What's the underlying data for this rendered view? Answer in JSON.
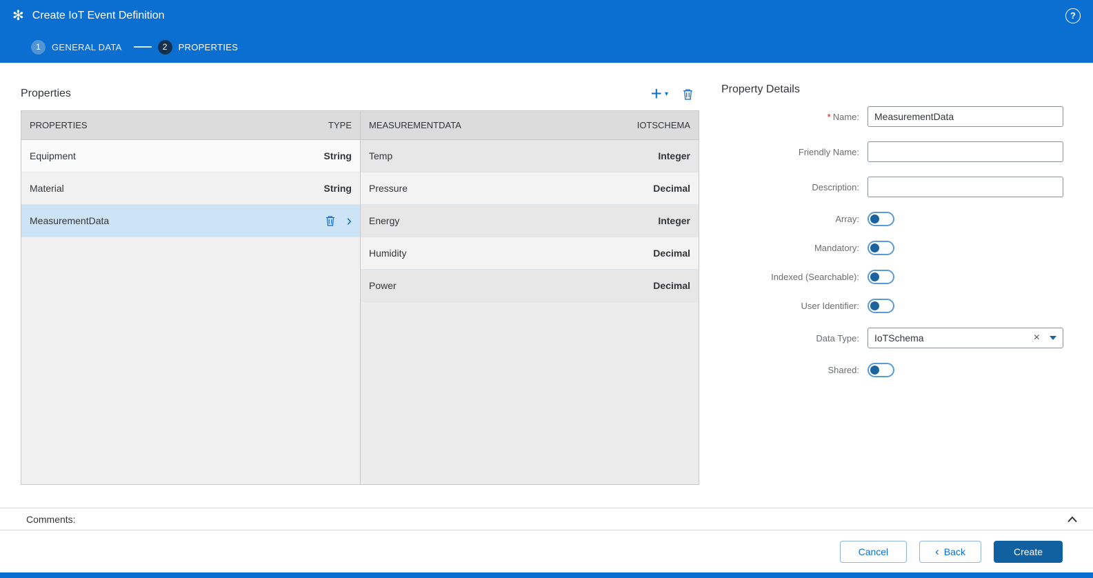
{
  "colors": {
    "header_blue": "#0a6fd1",
    "accent_blue": "#0a6ed1",
    "primary_button_blue": "#1161a0",
    "selected_row_blue": "#cde4f7"
  },
  "header": {
    "title": "Create IoT Event Definition",
    "logo_glyph": "✻",
    "help_glyph": "?"
  },
  "wizard": {
    "steps": [
      {
        "number": "1",
        "label": "GENERAL DATA",
        "state": "completed"
      },
      {
        "number": "2",
        "label": "PROPERTIES",
        "state": "active"
      }
    ]
  },
  "properties": {
    "title": "Properties",
    "toolbar": {
      "add_glyph": "+",
      "add_caret": "▾"
    },
    "main_table": {
      "headers": {
        "name": "PROPERTIES",
        "type": "TYPE"
      },
      "rows": [
        {
          "name": "Equipment",
          "type": "String"
        },
        {
          "name": "Material",
          "type": "String"
        },
        {
          "name": "MeasurementData",
          "type": "",
          "selected": true
        }
      ]
    },
    "sub_table": {
      "headers": {
        "name": "MEASUREMENTDATA",
        "type": "IOTSCHEMA"
      },
      "rows": [
        {
          "name": "Temp",
          "type": "Integer"
        },
        {
          "name": "Pressure",
          "type": "Decimal"
        },
        {
          "name": "Energy",
          "type": "Integer"
        },
        {
          "name": "Humidity",
          "type": "Decimal"
        },
        {
          "name": "Power",
          "type": "Decimal"
        }
      ]
    },
    "row_chevron": "›"
  },
  "details": {
    "title": "Property Details",
    "required_marker": "*",
    "name": {
      "label": "Name:",
      "value": "MeasurementData"
    },
    "friendly_name": {
      "label": "Friendly Name:",
      "value": ""
    },
    "description": {
      "label": "Description:",
      "value": ""
    },
    "array": {
      "label": "Array:",
      "state": "off"
    },
    "mandatory": {
      "label": "Mandatory:",
      "state": "off"
    },
    "indexed": {
      "label": "Indexed (Searchable):",
      "state": "off"
    },
    "user_identifier": {
      "label": "User Identifier:",
      "state": "off"
    },
    "data_type": {
      "label": "Data Type:",
      "value": "IoTSchema",
      "clear_glyph": "×"
    },
    "shared": {
      "label": "Shared:",
      "state": "off"
    }
  },
  "comments": {
    "label": "Comments:"
  },
  "footer": {
    "cancel_label": "Cancel",
    "back_chevron": "‹",
    "back_label": "Back",
    "create_label": "Create"
  }
}
